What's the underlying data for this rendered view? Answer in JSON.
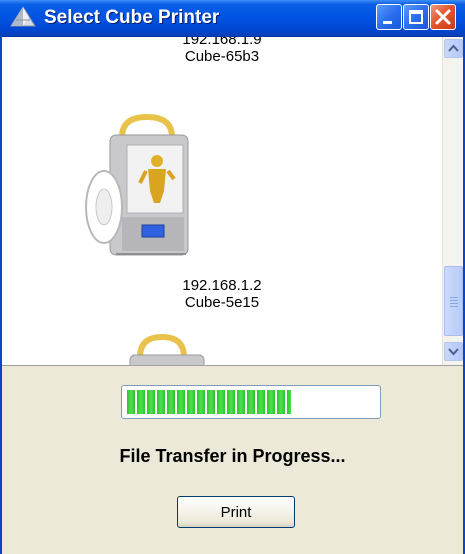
{
  "window": {
    "title": "Select Cube Printer",
    "icon": "cube-printer-app-icon",
    "controls": [
      "minimize-icon",
      "maximize-icon",
      "close-icon"
    ]
  },
  "printers": [
    {
      "ip": "192.168.1.9",
      "name": "Cube-65b3"
    },
    {
      "ip": "192.168.1.2",
      "name": "Cube-5e15"
    }
  ],
  "progress": {
    "value": 0.66
  },
  "status_text": "File Transfer in Progress...",
  "print_button": "Print",
  "colors": {
    "titlebar": "#0054e3",
    "progress_fill": "#2fc32f",
    "close_button": "#e4572f",
    "dialog_background": "#ece9d8"
  }
}
